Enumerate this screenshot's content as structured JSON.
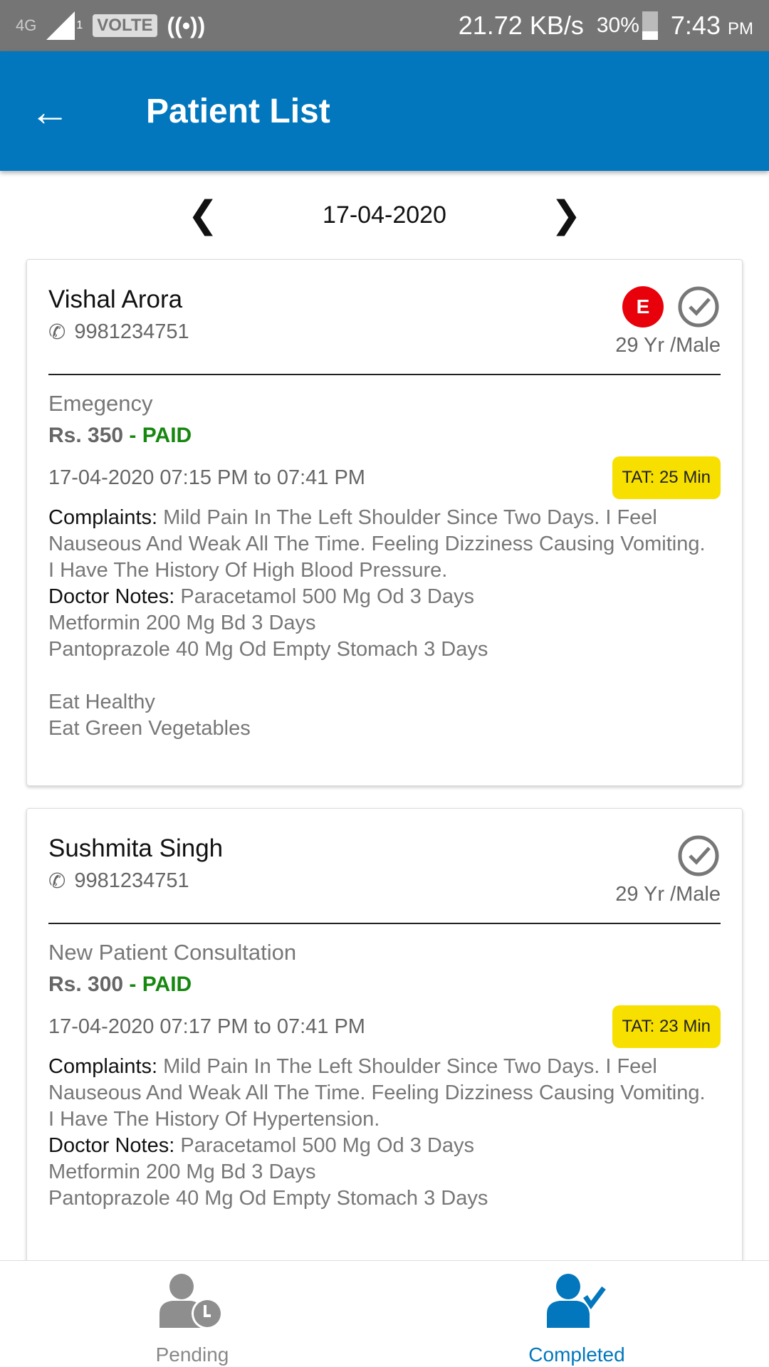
{
  "status_bar": {
    "network": "4G",
    "sim": "1",
    "volte": "VOLTE",
    "speed": "21.72 KB/s",
    "battery": "30%",
    "battery_level": 30,
    "time": "7:43",
    "ampm": "PM"
  },
  "header": {
    "title": "Patient List",
    "color": "#0277bd"
  },
  "date_nav": {
    "date": "17-04-2020"
  },
  "patients": [
    {
      "name": "Vishal Arora",
      "phone": "9981234751",
      "emergency_badge": "E",
      "age_gender": "29 Yr /Male",
      "type": "Emegency",
      "fee": "Rs. 350",
      "status": "- PAID",
      "time": "17-04-2020 07:15 PM to 07:41 PM",
      "tat": "TAT: 25 Min",
      "complaints_label": "Complaints:",
      "complaints": " Mild Pain In The Left Shoulder Since Two Days. I Feel Nauseous And Weak All The Time. Feeling Dizziness Causing Vomiting.\nI Have The History Of High Blood Pressure.",
      "notes_label": "Doctor Notes:",
      "notes": " Paracetamol 500 Mg Od 3 Days\nMetformin 200 Mg Bd 3 Days\nPantoprazole 40 Mg Od Empty Stomach 3 Days\n\nEat Healthy\nEat Green Vegetables"
    },
    {
      "name": "Sushmita Singh",
      "phone": "9981234751",
      "age_gender": "29 Yr /Male",
      "type": "New Patient Consultation",
      "fee": "Rs. 300",
      "status": "- PAID",
      "time": "17-04-2020 07:17 PM to 07:41 PM",
      "tat": "TAT: 23 Min",
      "complaints_label": "Complaints:",
      "complaints": " Mild Pain In The Left Shoulder Since Two Days. I Feel Nauseous And Weak All The Time. Feeling Dizziness Causing Vomiting.\nI Have The History Of Hypertension.",
      "notes_label": "Doctor Notes:",
      "notes": " Paracetamol 500 Mg Od 3 Days\nMetformin 200 Mg Bd 3 Days\nPantoprazole 40 Mg Od Empty Stomach 3 Days"
    }
  ],
  "bottom_nav": {
    "pending": "Pending",
    "completed": "Completed",
    "active": "Completed"
  }
}
